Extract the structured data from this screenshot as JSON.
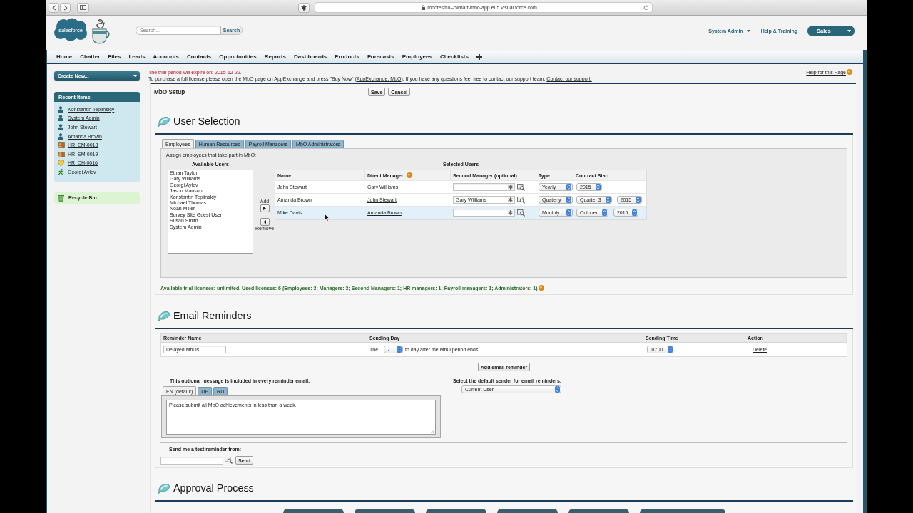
{
  "browser": {
    "url": "mbotestflo--cwharf-mbo-app.eu5.visual.force.com"
  },
  "header": {
    "logo": "salesforce",
    "search": {
      "placeholder": "Search...",
      "button": "Search"
    },
    "user_menu": "System Admin",
    "help": "Help & Training",
    "app_menu": "Sales"
  },
  "nav_tabs": [
    "Home",
    "Chatter",
    "Files",
    "Leads",
    "Accounts",
    "Contacts",
    "Opportunities",
    "Reports",
    "Dashboards",
    "Products",
    "Forecasts",
    "Employees",
    "Checklists"
  ],
  "sidebar": {
    "create_new": "Create New...",
    "recent_items": {
      "title": "Recent Items",
      "items": [
        {
          "label": "Konstantin Teplinskiy",
          "kind": "user"
        },
        {
          "label": "System Admin",
          "kind": "user"
        },
        {
          "label": "John Stewart",
          "kind": "user"
        },
        {
          "label": "Amanda Brown",
          "kind": "user"
        },
        {
          "label": "HR_EM-0018",
          "kind": "employee"
        },
        {
          "label": "HR_EM-0019",
          "kind": "employee"
        },
        {
          "label": "HR_CH-0016",
          "kind": "checklist"
        },
        {
          "label": "Georgi Aylov",
          "kind": "contact"
        }
      ]
    },
    "recycle_bin": "Recycle Bin"
  },
  "notice": {
    "trial": "The trial period will expire on: 2015-12-22.",
    "purchase": [
      {
        "kind": "text",
        "text": "To purchase a full license please open the MbO page on AppExchange and press \"Buy Now\" ("
      },
      {
        "kind": "link",
        "text": "AppExchange: MbO"
      },
      {
        "kind": "text",
        "text": "). If you have any questions feel free to contact our support team: "
      },
      {
        "kind": "link",
        "text": "Contact our support!"
      }
    ],
    "help_link": "Help for this Page"
  },
  "setup": {
    "title": "MbO Setup",
    "buttons": [
      "Save",
      "Cancel"
    ]
  },
  "user_selection": {
    "title": "User Selection",
    "tabs": [
      {
        "label": "Employees",
        "selected": true
      },
      {
        "label": "Human Resources",
        "selected": false
      },
      {
        "label": "Payroll Managers",
        "selected": false
      },
      {
        "label": "MbO Administrators",
        "selected": false
      }
    ],
    "instruction": "Assign employees that take part in MbO:",
    "available": {
      "title": "Available Users",
      "items": [
        "Ethan Taylor",
        "Gary Williams",
        "Georgi Aylov",
        "Jason Manson",
        "Konstantin Teplinskiy",
        "Michael Thomas",
        "Noah Miller",
        "Survey Site Guest User",
        "Susan Smith",
        "System Admin"
      ]
    },
    "add_label": "Add",
    "remove_label": "Remove",
    "selected": {
      "title": "Selected Users",
      "columns": [
        "Name",
        "Direct Manager",
        "Second Manager (optional)",
        "Type",
        "Contract Start"
      ],
      "rows": [
        {
          "name": "John Stewart",
          "direct_manager": "Gary Williams",
          "type": "Yearly",
          "contract_start": [
            "2015"
          ],
          "hovered": false
        },
        {
          "name": "Amanda Brown",
          "direct_manager": "John Stewart",
          "second_manager": "Gary Williams",
          "type": "Quaterly",
          "contract_start": [
            "Quarter 3",
            "2015"
          ],
          "hovered": false
        },
        {
          "name": "Mike Davis",
          "direct_manager": "Amanda Brown",
          "type": "Monthly",
          "contract_start": [
            "October",
            "2015"
          ],
          "hovered": true
        }
      ]
    },
    "licenses": "Available trial licenses: unlimited. Used licenses: 6 (Employees: 3; Managers: 3; Second Managers: 1; HR managers: 1; Payroll managers: 1; Administrators: 1)"
  },
  "email": {
    "title": "Email Reminders",
    "columns": [
      "Reminder Name",
      "Sending Day",
      "Sending Time",
      "Action"
    ],
    "rows": [
      {
        "name": "Delayed MbOs",
        "day_before": "The",
        "day": "7",
        "day_after": "th day after the MbO period ends",
        "time": "10:00",
        "action": "Delete"
      }
    ],
    "add_button": "Add email reminder",
    "message": {
      "label": "This optional message is included in every reminder email:",
      "tabs": [
        {
          "label": "EN (default)",
          "selected": true
        },
        {
          "label": "DE",
          "selected": false
        },
        {
          "label": "RU",
          "selected": false
        }
      ],
      "text": "Please submit all MbO achievements in less than a week."
    },
    "sender": {
      "label": "Select the default sender for email reminders:",
      "value": "Current User"
    },
    "test": {
      "label": "Send me a test reminder from:",
      "button": "Send"
    }
  },
  "approval": {
    "title": "Approval Process"
  }
}
